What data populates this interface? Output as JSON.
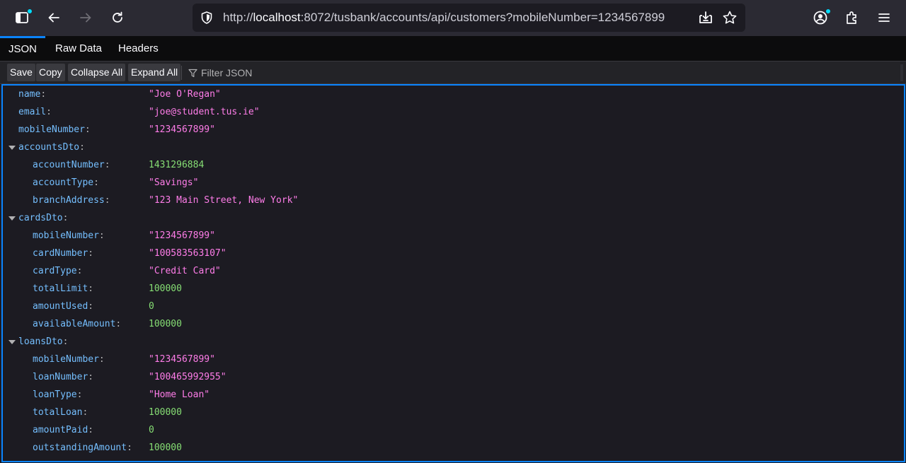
{
  "browser": {
    "url_host_prefix": "http://",
    "url_host": "localhost",
    "url_rest": ":8072/tusbank/accounts/api/customers?mobileNumber=1234567899"
  },
  "tabs": [
    "JSON",
    "Raw Data",
    "Headers"
  ],
  "actions": {
    "save": "Save",
    "copy": "Copy",
    "collapse": "Collapse All",
    "expand": "Expand All",
    "filter_placeholder": "Filter JSON"
  },
  "json": {
    "name": {
      "key": "name",
      "value": "\"Joe O'Regan\""
    },
    "email": {
      "key": "email",
      "value": "\"joe@student.tus.ie\""
    },
    "mobileNumber": {
      "key": "mobileNumber",
      "value": "\"1234567899\""
    },
    "accountsDto": {
      "key": "accountsDto",
      "accountNumber": {
        "key": "accountNumber",
        "value": "1431296884"
      },
      "accountType": {
        "key": "accountType",
        "value": "\"Savings\""
      },
      "branchAddress": {
        "key": "branchAddress",
        "value": "\"123 Main Street, New York\""
      }
    },
    "cardsDto": {
      "key": "cardsDto",
      "mobileNumber": {
        "key": "mobileNumber",
        "value": "\"1234567899\""
      },
      "cardNumber": {
        "key": "cardNumber",
        "value": "\"100583563107\""
      },
      "cardType": {
        "key": "cardType",
        "value": "\"Credit Card\""
      },
      "totalLimit": {
        "key": "totalLimit",
        "value": "100000"
      },
      "amountUsed": {
        "key": "amountUsed",
        "value": "0"
      },
      "availableAmount": {
        "key": "availableAmount",
        "value": "100000"
      }
    },
    "loansDto": {
      "key": "loansDto",
      "mobileNumber": {
        "key": "mobileNumber",
        "value": "\"1234567899\""
      },
      "loanNumber": {
        "key": "loanNumber",
        "value": "\"100465992955\""
      },
      "loanType": {
        "key": "loanType",
        "value": "\"Home Loan\""
      },
      "totalLoan": {
        "key": "totalLoan",
        "value": "100000"
      },
      "amountPaid": {
        "key": "amountPaid",
        "value": "0"
      },
      "outstandingAmount": {
        "key": "outstandingAmount",
        "value": "100000"
      }
    }
  },
  "colors": {
    "key": "#75bfff",
    "string": "#ff7de9",
    "number": "#86de74",
    "accent": "#0a84ff"
  },
  "icons": [
    "sidebar-icon",
    "back-icon",
    "forward-icon",
    "reload-icon",
    "shield-icon",
    "download-icon",
    "star-icon",
    "account-icon",
    "extensions-icon",
    "menu-icon",
    "filter-icon"
  ]
}
